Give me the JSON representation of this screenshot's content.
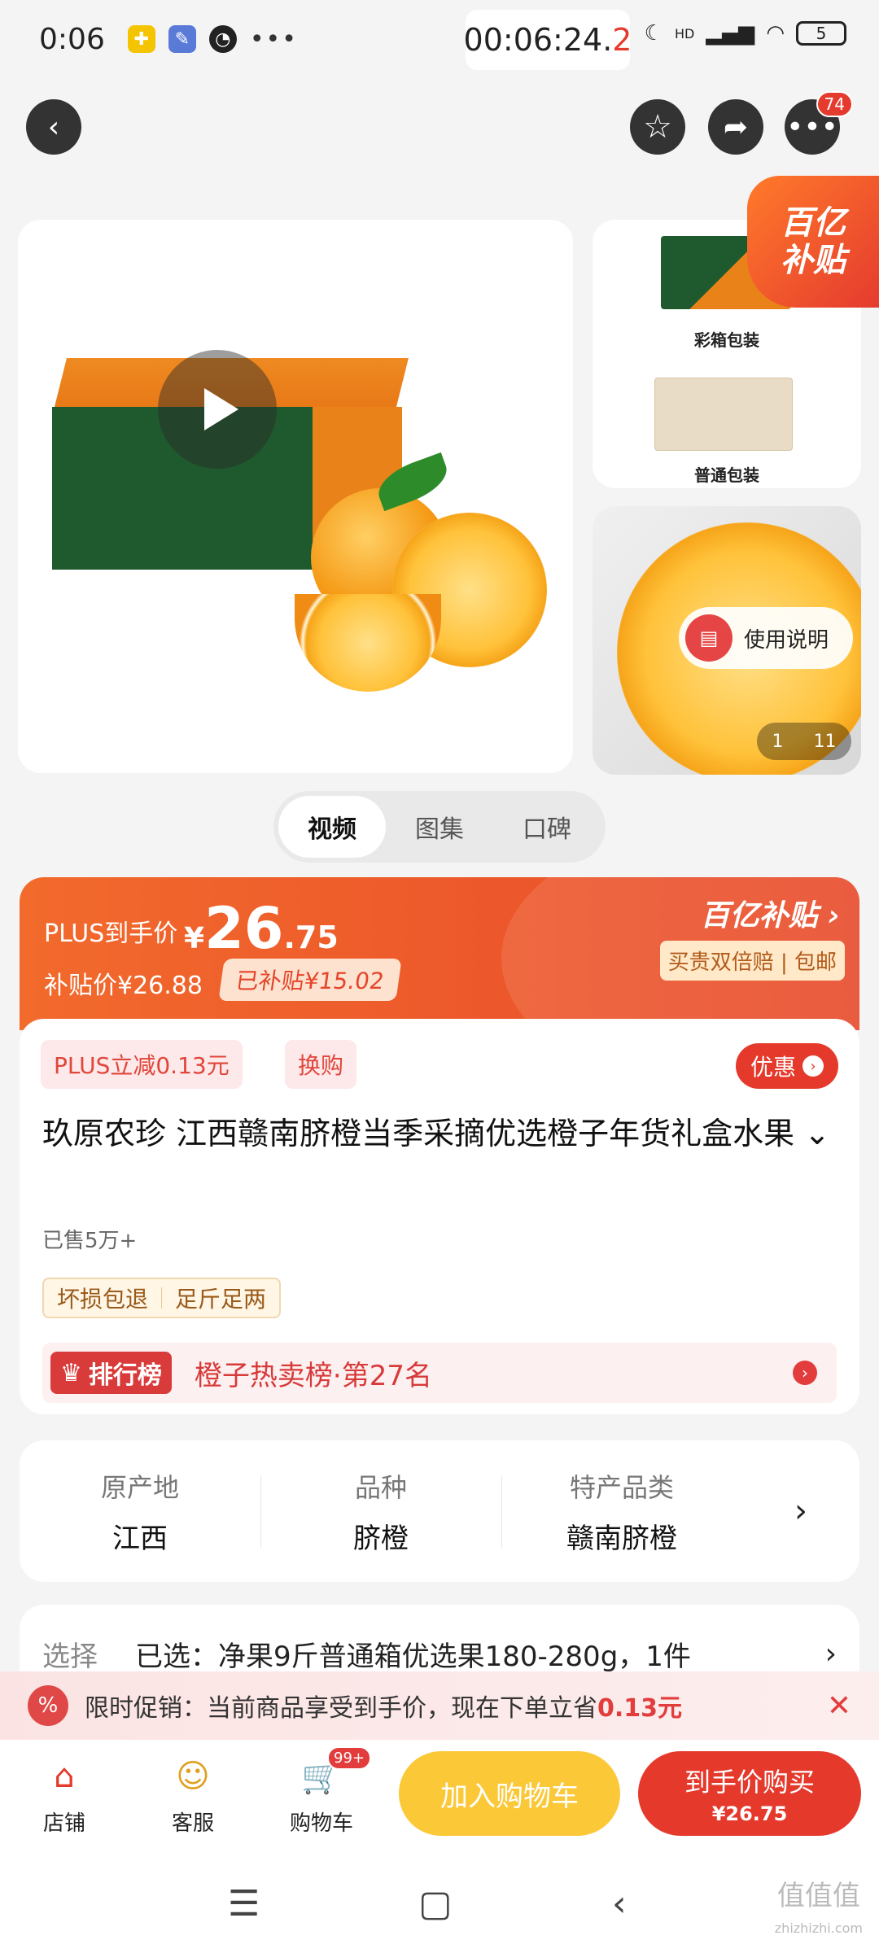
{
  "status_bar": {
    "time": "0:06",
    "timer_main": "00:06:24.",
    "timer_tail": "2",
    "battery": "5",
    "network": "HD"
  },
  "topnav": {
    "back_icon": "chevron-left-icon",
    "badge": "74"
  },
  "gallery": {
    "thumb1_label": "彩箱包装",
    "thumb2_label": "普通包装",
    "yibt_line1": "百亿",
    "yibt_line2": "补贴",
    "howto": "使用说明",
    "page_current": "1",
    "page_total": "11"
  },
  "media_tabs": [
    {
      "label": "视频",
      "active": true
    },
    {
      "label": "图集",
      "active": false
    },
    {
      "label": "口碑",
      "active": false
    }
  ],
  "price": {
    "plus_label": "PLUS到手价",
    "yen": "¥",
    "int": "26",
    "dec": ".75",
    "subsidy_price": "补贴价¥26.88",
    "subsidized": "已补贴¥15.02",
    "brand": "百亿补贴 ›",
    "guarantee": "买贵双倍赔 | 包邮"
  },
  "info": {
    "chip_plus": "PLUS立减0.13元",
    "chip_swap": "换购",
    "coupon": "优惠",
    "title": "玖原农珍 江西赣南脐橙当季采摘优选橙子年货礼盒水果 ⌄",
    "sold": "已售5万+",
    "tag1": "坏损包退",
    "tag2": "足斤足两",
    "rank_tag": "排行榜",
    "rank_text": "橙子热卖榜·第27名"
  },
  "attributes": [
    {
      "key": "原产地",
      "value": "江西"
    },
    {
      "key": "品种",
      "value": "脐橙"
    },
    {
      "key": "特产品类",
      "value": "赣南脐橙"
    }
  ],
  "select": {
    "label": "选择",
    "value": "已选：净果9斤普通箱优选果180-280g，1件"
  },
  "promo": {
    "text": "限时促销：当前商品享受到手价，现在下单立省",
    "amount": "0.13元"
  },
  "actionbar": {
    "shop": "店铺",
    "service": "客服",
    "cart": "购物车",
    "cart_badge": "99+",
    "add_cart": "加入购物车",
    "buy_line1": "到手价购买",
    "buy_line2": "¥26.75"
  },
  "watermark": {
    "big": "值值值",
    "small": "zhizhizhi.com"
  },
  "colors": {
    "accent_red": "#e5392c",
    "accent_orange": "#f26a2c",
    "yellow": "#fbc838"
  }
}
